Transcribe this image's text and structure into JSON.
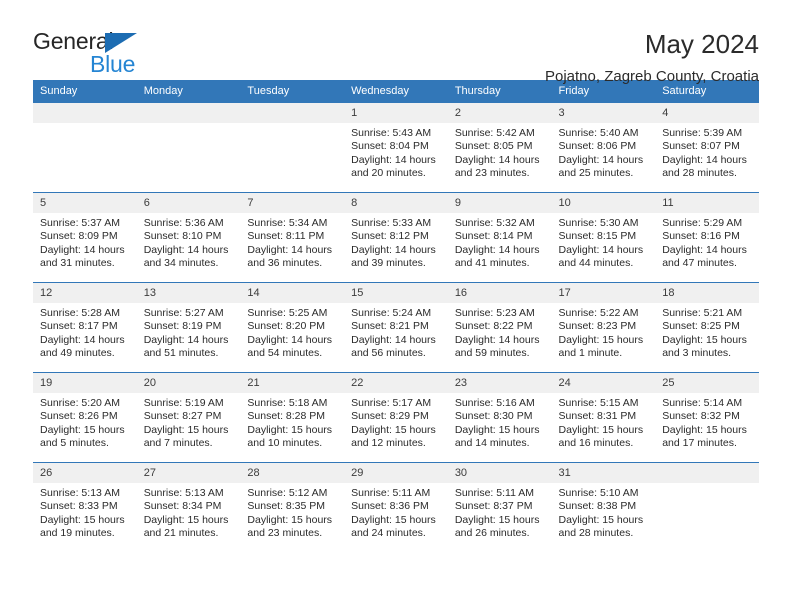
{
  "logo": {
    "word_top": "General",
    "word_bottom": "Blue",
    "triangle_icon": "triangle-icon",
    "color_dark": "#262626",
    "color_blue": "#2585d3"
  },
  "header": {
    "title": "May 2024",
    "subtitle": "Pojatno, Zagreb County, Croatia"
  },
  "theme": {
    "header_blue": "#3277b8",
    "daynum_bg": "#f0f0f0",
    "text": "#2b2b2b"
  },
  "calendar": {
    "weekday_headers": [
      "Sunday",
      "Monday",
      "Tuesday",
      "Wednesday",
      "Thursday",
      "Friday",
      "Saturday"
    ],
    "weeks": [
      [
        {
          "day": "",
          "sunrise": "",
          "sunset": "",
          "daylight_line1": "",
          "daylight_line2": ""
        },
        {
          "day": "",
          "sunrise": "",
          "sunset": "",
          "daylight_line1": "",
          "daylight_line2": ""
        },
        {
          "day": "",
          "sunrise": "",
          "sunset": "",
          "daylight_line1": "",
          "daylight_line2": ""
        },
        {
          "day": "1",
          "sunrise": "Sunrise: 5:43 AM",
          "sunset": "Sunset: 8:04 PM",
          "daylight_line1": "Daylight: 14 hours",
          "daylight_line2": "and 20 minutes."
        },
        {
          "day": "2",
          "sunrise": "Sunrise: 5:42 AM",
          "sunset": "Sunset: 8:05 PM",
          "daylight_line1": "Daylight: 14 hours",
          "daylight_line2": "and 23 minutes."
        },
        {
          "day": "3",
          "sunrise": "Sunrise: 5:40 AM",
          "sunset": "Sunset: 8:06 PM",
          "daylight_line1": "Daylight: 14 hours",
          "daylight_line2": "and 25 minutes."
        },
        {
          "day": "4",
          "sunrise": "Sunrise: 5:39 AM",
          "sunset": "Sunset: 8:07 PM",
          "daylight_line1": "Daylight: 14 hours",
          "daylight_line2": "and 28 minutes."
        }
      ],
      [
        {
          "day": "5",
          "sunrise": "Sunrise: 5:37 AM",
          "sunset": "Sunset: 8:09 PM",
          "daylight_line1": "Daylight: 14 hours",
          "daylight_line2": "and 31 minutes."
        },
        {
          "day": "6",
          "sunrise": "Sunrise: 5:36 AM",
          "sunset": "Sunset: 8:10 PM",
          "daylight_line1": "Daylight: 14 hours",
          "daylight_line2": "and 34 minutes."
        },
        {
          "day": "7",
          "sunrise": "Sunrise: 5:34 AM",
          "sunset": "Sunset: 8:11 PM",
          "daylight_line1": "Daylight: 14 hours",
          "daylight_line2": "and 36 minutes."
        },
        {
          "day": "8",
          "sunrise": "Sunrise: 5:33 AM",
          "sunset": "Sunset: 8:12 PM",
          "daylight_line1": "Daylight: 14 hours",
          "daylight_line2": "and 39 minutes."
        },
        {
          "day": "9",
          "sunrise": "Sunrise: 5:32 AM",
          "sunset": "Sunset: 8:14 PM",
          "daylight_line1": "Daylight: 14 hours",
          "daylight_line2": "and 41 minutes."
        },
        {
          "day": "10",
          "sunrise": "Sunrise: 5:30 AM",
          "sunset": "Sunset: 8:15 PM",
          "daylight_line1": "Daylight: 14 hours",
          "daylight_line2": "and 44 minutes."
        },
        {
          "day": "11",
          "sunrise": "Sunrise: 5:29 AM",
          "sunset": "Sunset: 8:16 PM",
          "daylight_line1": "Daylight: 14 hours",
          "daylight_line2": "and 47 minutes."
        }
      ],
      [
        {
          "day": "12",
          "sunrise": "Sunrise: 5:28 AM",
          "sunset": "Sunset: 8:17 PM",
          "daylight_line1": "Daylight: 14 hours",
          "daylight_line2": "and 49 minutes."
        },
        {
          "day": "13",
          "sunrise": "Sunrise: 5:27 AM",
          "sunset": "Sunset: 8:19 PM",
          "daylight_line1": "Daylight: 14 hours",
          "daylight_line2": "and 51 minutes."
        },
        {
          "day": "14",
          "sunrise": "Sunrise: 5:25 AM",
          "sunset": "Sunset: 8:20 PM",
          "daylight_line1": "Daylight: 14 hours",
          "daylight_line2": "and 54 minutes."
        },
        {
          "day": "15",
          "sunrise": "Sunrise: 5:24 AM",
          "sunset": "Sunset: 8:21 PM",
          "daylight_line1": "Daylight: 14 hours",
          "daylight_line2": "and 56 minutes."
        },
        {
          "day": "16",
          "sunrise": "Sunrise: 5:23 AM",
          "sunset": "Sunset: 8:22 PM",
          "daylight_line1": "Daylight: 14 hours",
          "daylight_line2": "and 59 minutes."
        },
        {
          "day": "17",
          "sunrise": "Sunrise: 5:22 AM",
          "sunset": "Sunset: 8:23 PM",
          "daylight_line1": "Daylight: 15 hours",
          "daylight_line2": "and 1 minute."
        },
        {
          "day": "18",
          "sunrise": "Sunrise: 5:21 AM",
          "sunset": "Sunset: 8:25 PM",
          "daylight_line1": "Daylight: 15 hours",
          "daylight_line2": "and 3 minutes."
        }
      ],
      [
        {
          "day": "19",
          "sunrise": "Sunrise: 5:20 AM",
          "sunset": "Sunset: 8:26 PM",
          "daylight_line1": "Daylight: 15 hours",
          "daylight_line2": "and 5 minutes."
        },
        {
          "day": "20",
          "sunrise": "Sunrise: 5:19 AM",
          "sunset": "Sunset: 8:27 PM",
          "daylight_line1": "Daylight: 15 hours",
          "daylight_line2": "and 7 minutes."
        },
        {
          "day": "21",
          "sunrise": "Sunrise: 5:18 AM",
          "sunset": "Sunset: 8:28 PM",
          "daylight_line1": "Daylight: 15 hours",
          "daylight_line2": "and 10 minutes."
        },
        {
          "day": "22",
          "sunrise": "Sunrise: 5:17 AM",
          "sunset": "Sunset: 8:29 PM",
          "daylight_line1": "Daylight: 15 hours",
          "daylight_line2": "and 12 minutes."
        },
        {
          "day": "23",
          "sunrise": "Sunrise: 5:16 AM",
          "sunset": "Sunset: 8:30 PM",
          "daylight_line1": "Daylight: 15 hours",
          "daylight_line2": "and 14 minutes."
        },
        {
          "day": "24",
          "sunrise": "Sunrise: 5:15 AM",
          "sunset": "Sunset: 8:31 PM",
          "daylight_line1": "Daylight: 15 hours",
          "daylight_line2": "and 16 minutes."
        },
        {
          "day": "25",
          "sunrise": "Sunrise: 5:14 AM",
          "sunset": "Sunset: 8:32 PM",
          "daylight_line1": "Daylight: 15 hours",
          "daylight_line2": "and 17 minutes."
        }
      ],
      [
        {
          "day": "26",
          "sunrise": "Sunrise: 5:13 AM",
          "sunset": "Sunset: 8:33 PM",
          "daylight_line1": "Daylight: 15 hours",
          "daylight_line2": "and 19 minutes."
        },
        {
          "day": "27",
          "sunrise": "Sunrise: 5:13 AM",
          "sunset": "Sunset: 8:34 PM",
          "daylight_line1": "Daylight: 15 hours",
          "daylight_line2": "and 21 minutes."
        },
        {
          "day": "28",
          "sunrise": "Sunrise: 5:12 AM",
          "sunset": "Sunset: 8:35 PM",
          "daylight_line1": "Daylight: 15 hours",
          "daylight_line2": "and 23 minutes."
        },
        {
          "day": "29",
          "sunrise": "Sunrise: 5:11 AM",
          "sunset": "Sunset: 8:36 PM",
          "daylight_line1": "Daylight: 15 hours",
          "daylight_line2": "and 24 minutes."
        },
        {
          "day": "30",
          "sunrise": "Sunrise: 5:11 AM",
          "sunset": "Sunset: 8:37 PM",
          "daylight_line1": "Daylight: 15 hours",
          "daylight_line2": "and 26 minutes."
        },
        {
          "day": "31",
          "sunrise": "Sunrise: 5:10 AM",
          "sunset": "Sunset: 8:38 PM",
          "daylight_line1": "Daylight: 15 hours",
          "daylight_line2": "and 28 minutes."
        },
        {
          "day": "",
          "sunrise": "",
          "sunset": "",
          "daylight_line1": "",
          "daylight_line2": ""
        }
      ]
    ]
  }
}
